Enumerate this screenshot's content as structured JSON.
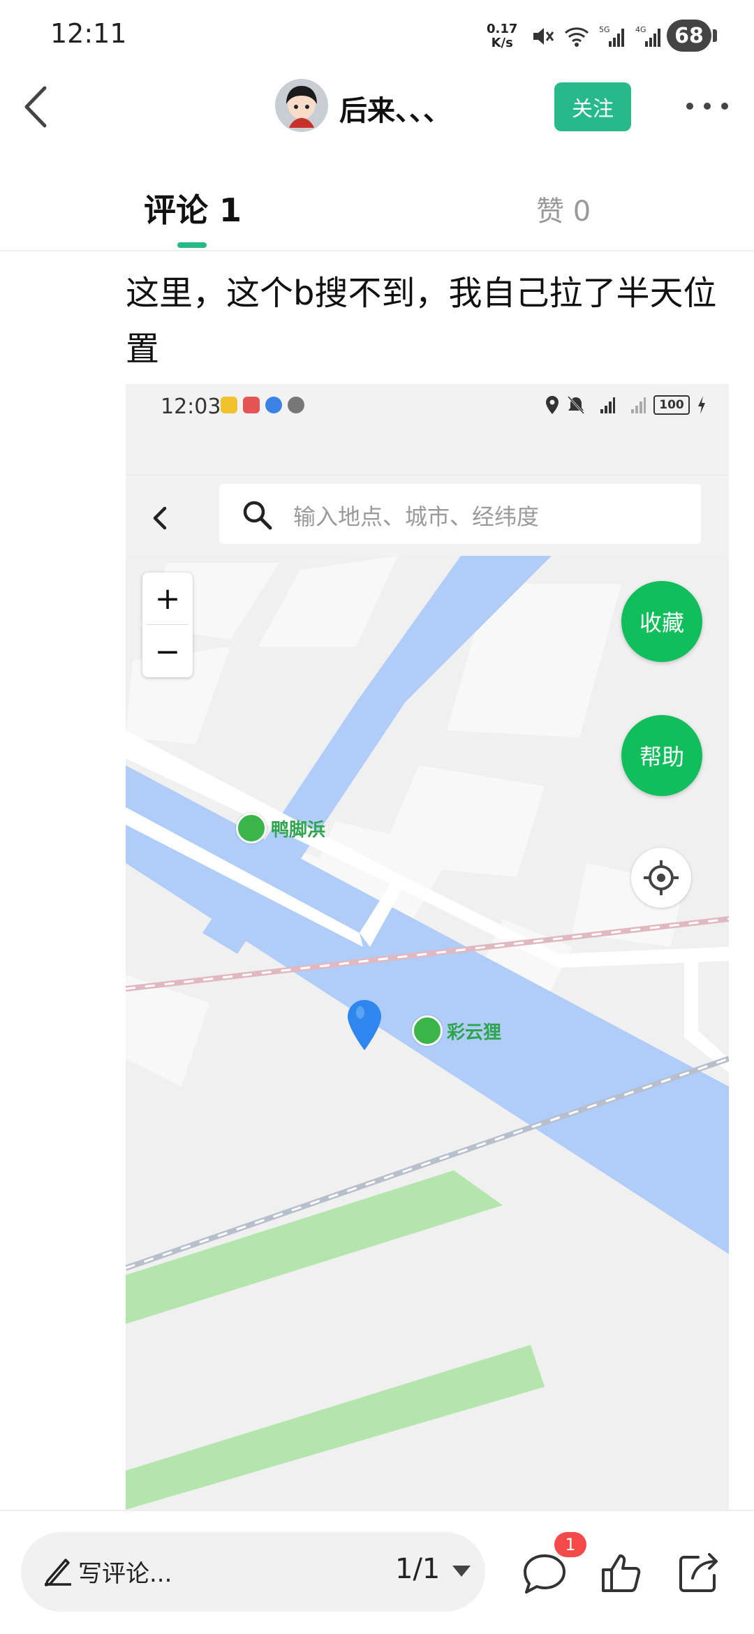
{
  "status_bar": {
    "time": "12:11",
    "net_speed_top": "0.17",
    "net_speed_bottom": "K/s",
    "battery": "68"
  },
  "header": {
    "username": "后来、、、",
    "follow_label": "关注"
  },
  "tabs": {
    "comments": "评论 1",
    "likes": "赞 0"
  },
  "comment": {
    "text": "这里，这个b搜不到，我自己拉了半天位置"
  },
  "embedded_screenshot": {
    "status_time": "12:03",
    "battery": "100",
    "search_placeholder": "输入地点、城市、经纬度",
    "zoom_in": "+",
    "zoom_out": "−",
    "collect_label": "收藏",
    "help_label": "帮助",
    "poi_1": "鸭脚浜",
    "poi_2": "彩云狸"
  },
  "bottom_bar": {
    "comment_placeholder": "写评论...",
    "page_indicator": "1/1",
    "chat_badge": "1"
  }
}
